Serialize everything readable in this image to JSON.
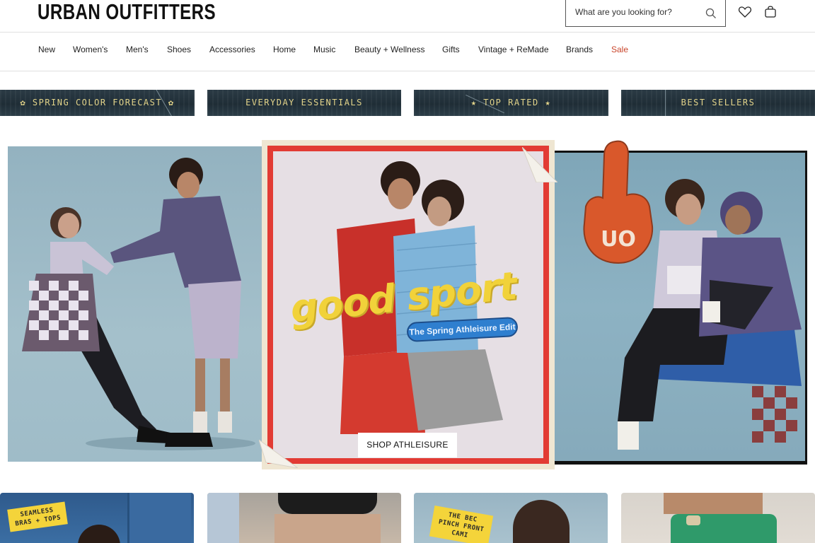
{
  "brand": {
    "logo_text": "URBAN OUTFITTERS"
  },
  "search": {
    "placeholder": "What are you looking for?"
  },
  "header_icons": {
    "search": "search-icon",
    "wishlist": "heart-icon",
    "bag": "shopping-bag-icon"
  },
  "nav": {
    "items": [
      {
        "label": "New"
      },
      {
        "label": "Women's"
      },
      {
        "label": "Men's"
      },
      {
        "label": "Shoes"
      },
      {
        "label": "Accessories"
      },
      {
        "label": "Home"
      },
      {
        "label": "Music"
      },
      {
        "label": "Beauty + Wellness"
      },
      {
        "label": "Gifts"
      },
      {
        "label": "Vintage + ReMade"
      },
      {
        "label": "Brands"
      },
      {
        "label": "Sale"
      }
    ]
  },
  "promos": [
    {
      "label": "✿ SPRING COLOR FORECAST ✿"
    },
    {
      "label": "EVERYDAY ESSENTIALS"
    },
    {
      "label": "★ TOP RATED ★"
    },
    {
      "label": "BEST SELLERS"
    }
  ],
  "hero": {
    "headline": "good sport",
    "badge": "The Spring Athleisure Edit",
    "cta": "SHOP ATHLEISURE",
    "finger_text": "UO"
  },
  "tiles": [
    {
      "sticker": "SEAMLESS BRAS + TOPS"
    },
    {
      "sticker": ""
    },
    {
      "sticker": "THE BEC PINCH FRONT CAMI"
    },
    {
      "sticker": ""
    }
  ],
  "colors": {
    "sale": "#c9452b",
    "promo_text": "#e3d48a",
    "hero_red": "#e23b34",
    "headline_yellow": "#f1d23a",
    "badge_blue": "#2f7fcf"
  }
}
